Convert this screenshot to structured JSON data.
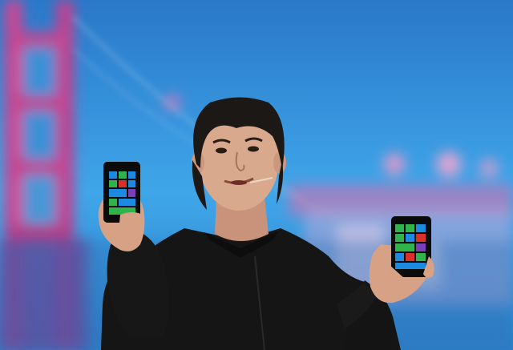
{
  "scene": {
    "subject": "presenter-holding-two-phones",
    "colors": {
      "sky_top": "#2f86d6",
      "sky_bottom": "#3da7e8",
      "bridge_pink": "#e0499a",
      "jacket": "#151515",
      "skin": "#d9a98d",
      "hair": "#1c1816",
      "tile_blue": "#1b8ae0",
      "tile_green": "#2fb34a",
      "tile_red": "#d8312b",
      "tile_purple": "#7a3fb8"
    },
    "icons": [
      "phone-screen-tiles-icon",
      "phone-screen-tiles-icon"
    ]
  }
}
